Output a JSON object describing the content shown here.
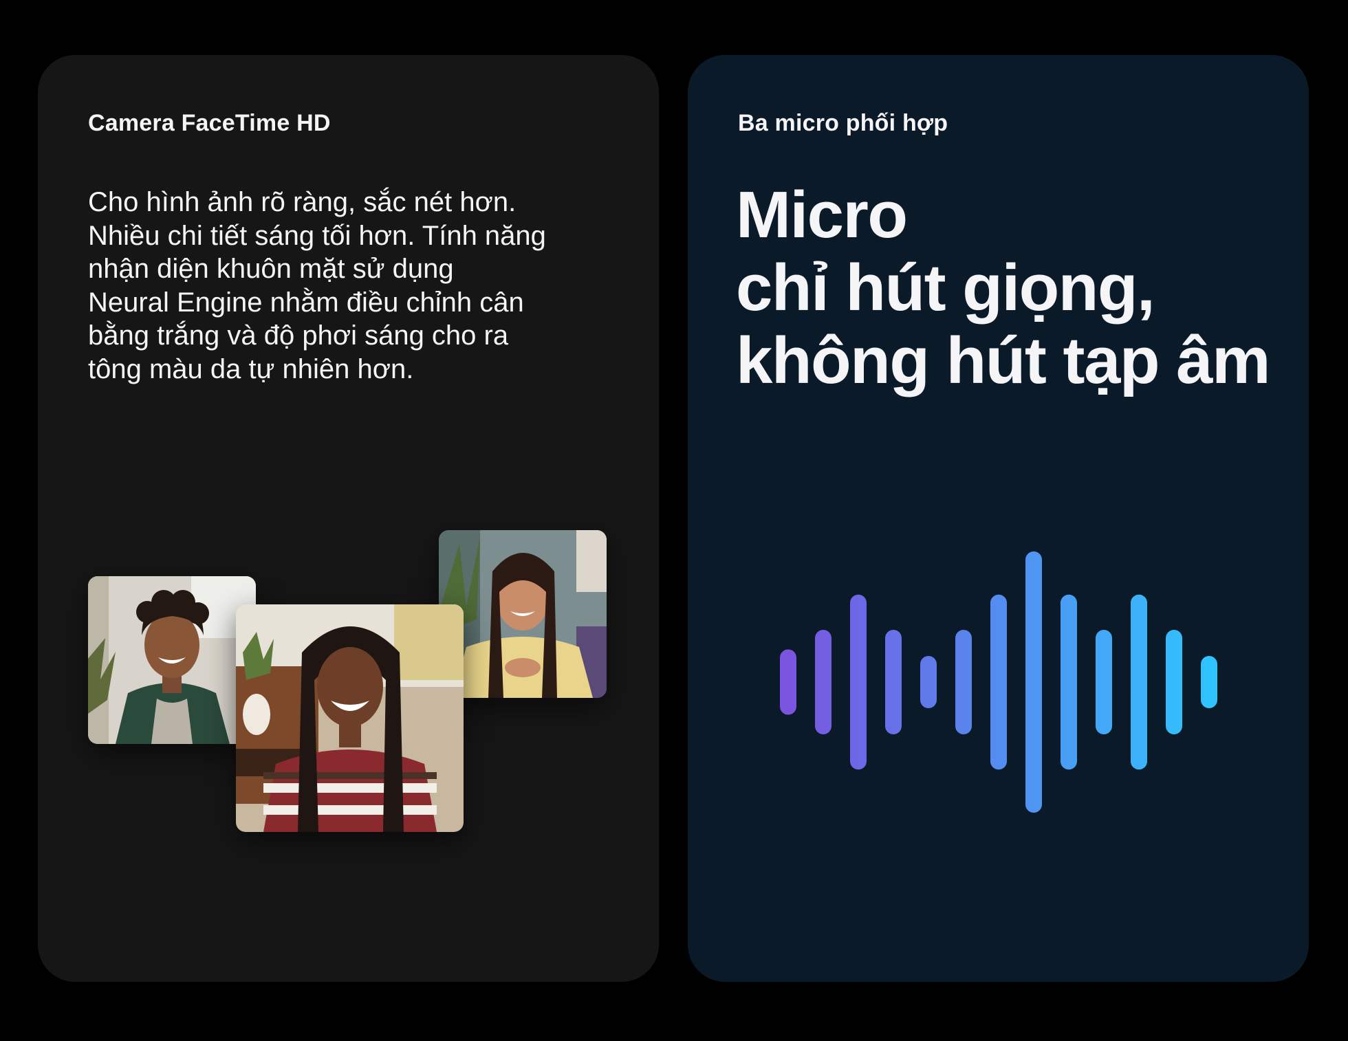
{
  "left_card": {
    "eyebrow": "Camera FaceTime HD",
    "body_lines": [
      "Cho hình ảnh rõ ràng, sắc nét hơn.",
      "Nhiều chi tiết sáng tối hơn. Tính năng",
      "nhận diện khuôn mặt sử dụng",
      "Neural Engine nhằm điều chỉnh cân",
      "bằng trắng và độ phơi sáng cho ra",
      "tông màu da tự nhiên hơn."
    ],
    "tiles": [
      {
        "name": "facetime-tile-boy"
      },
      {
        "name": "facetime-tile-girl-right"
      },
      {
        "name": "facetime-tile-girl-center"
      }
    ]
  },
  "right_card": {
    "eyebrow": "Ba micro phối hợp",
    "headline_lines": [
      "Micro",
      "chỉ hút giọng,",
      "không hút tạp âm"
    ],
    "waveform": {
      "levels": [
        0.25,
        0.4,
        0.67,
        0.4,
        0.2,
        0.4,
        0.67,
        1.0,
        0.67,
        0.4,
        0.67,
        0.4,
        0.2
      ],
      "gradient_start": "#7a55e0",
      "gradient_end": "#2fc4ff"
    }
  },
  "colors": {
    "page_background": "#000000",
    "left_card_background": "#161617",
    "right_card_background": "#0b1a28",
    "text": "#f5f5f7"
  }
}
